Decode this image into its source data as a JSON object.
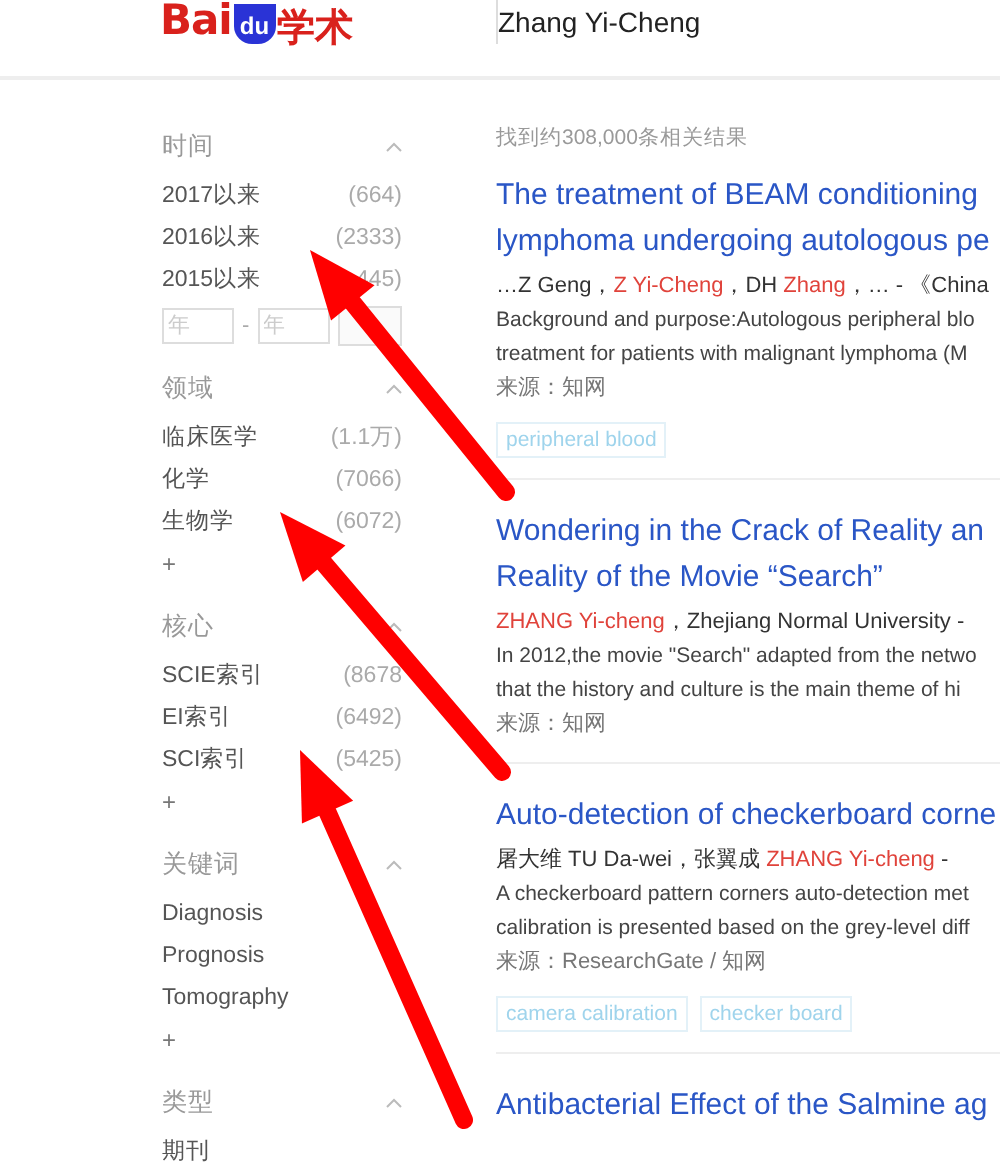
{
  "header": {
    "logo_latin": "Bai",
    "logo_badge": "du",
    "logo_cjk": "学术",
    "search": {
      "value": "Zhang Yi-Cheng"
    }
  },
  "sidebar": [
    {
      "title": "时间",
      "expanded": true,
      "items": [
        {
          "label": "2017以来",
          "count": "(664)"
        },
        {
          "label": "2016以来",
          "count": "(2333)"
        },
        {
          "label": "2015以来",
          "count": "445)"
        }
      ],
      "year_range": {
        "from_placeholder": "年",
        "separator": "-",
        "to_placeholder": "年"
      }
    },
    {
      "title": "领域",
      "expanded": true,
      "items": [
        {
          "label": "临床医学",
          "count": "(1.1万)"
        },
        {
          "label": "化学",
          "count": "(7066)"
        },
        {
          "label": "生物学",
          "count": "(6072)"
        }
      ],
      "more": "+"
    },
    {
      "title": "核心",
      "expanded": true,
      "items": [
        {
          "label": "SCIE索引",
          "count": "(8678"
        },
        {
          "label": "EI索引",
          "count": "(6492)"
        },
        {
          "label": "SCI索引",
          "count": "(5425)"
        }
      ],
      "more": "+"
    },
    {
      "title": "关键词",
      "expanded": true,
      "items": [
        {
          "label": "Diagnosis"
        },
        {
          "label": "Prognosis"
        },
        {
          "label": "Tomography"
        }
      ],
      "more": "+"
    },
    {
      "title": "类型",
      "expanded": true,
      "items": [
        {
          "label": "期刊"
        }
      ]
    }
  ],
  "result_count": "找到约308,000条相关结果",
  "results": [
    {
      "title_lines": [
        "The treatment of BEAM conditioning",
        "lymphoma undergoing autologous pe"
      ],
      "authors": [
        {
          "text": "…Z Geng，",
          "highlight": false
        },
        {
          "text": "Z Yi-Cheng",
          "highlight": true
        },
        {
          "text": "，DH ",
          "highlight": false
        },
        {
          "text": "Zhang",
          "highlight": true
        },
        {
          "text": "，… - 《China",
          "highlight": false
        }
      ],
      "abstract_lines": [
        "Background and purpose:Autologous peripheral blo",
        "treatment for patients with malignant lymphoma (M"
      ],
      "source": "来源：知网",
      "tags": [
        "peripheral blood"
      ]
    },
    {
      "title_lines": [
        "Wondering in the Crack of Reality an",
        "Reality of the Movie “Search”"
      ],
      "authors": [
        {
          "text": "ZHANG Yi-cheng",
          "highlight": true
        },
        {
          "text": "，Zhejiang Normal University -",
          "highlight": false
        }
      ],
      "abstract_lines": [
        "In 2012,the movie \"Search\" adapted from the netwo",
        "that the history and culture is the main theme of hi"
      ],
      "source": "来源：知网"
    },
    {
      "title_lines": [
        "Auto-detection of checkerboard corne"
      ],
      "authors": [
        {
          "text": "屠大维 TU Da-wei，张翼成 ",
          "highlight": false
        },
        {
          "text": "ZHANG Yi-cheng",
          "highlight": true
        },
        {
          "text": " -",
          "highlight": false
        }
      ],
      "abstract_lines": [
        "A checkerboard pattern corners auto-detection met",
        "calibration is presented based on the grey-level diff"
      ],
      "source": "来源：ResearchGate / 知网",
      "tags": [
        "camera calibration",
        "checker board"
      ]
    },
    {
      "title_lines": [
        "Antibacterial Effect of the Salmine ag"
      ]
    }
  ],
  "annotations": [
    {
      "kind": "arrow"
    },
    {
      "kind": "arrow"
    },
    {
      "kind": "arrow"
    }
  ]
}
